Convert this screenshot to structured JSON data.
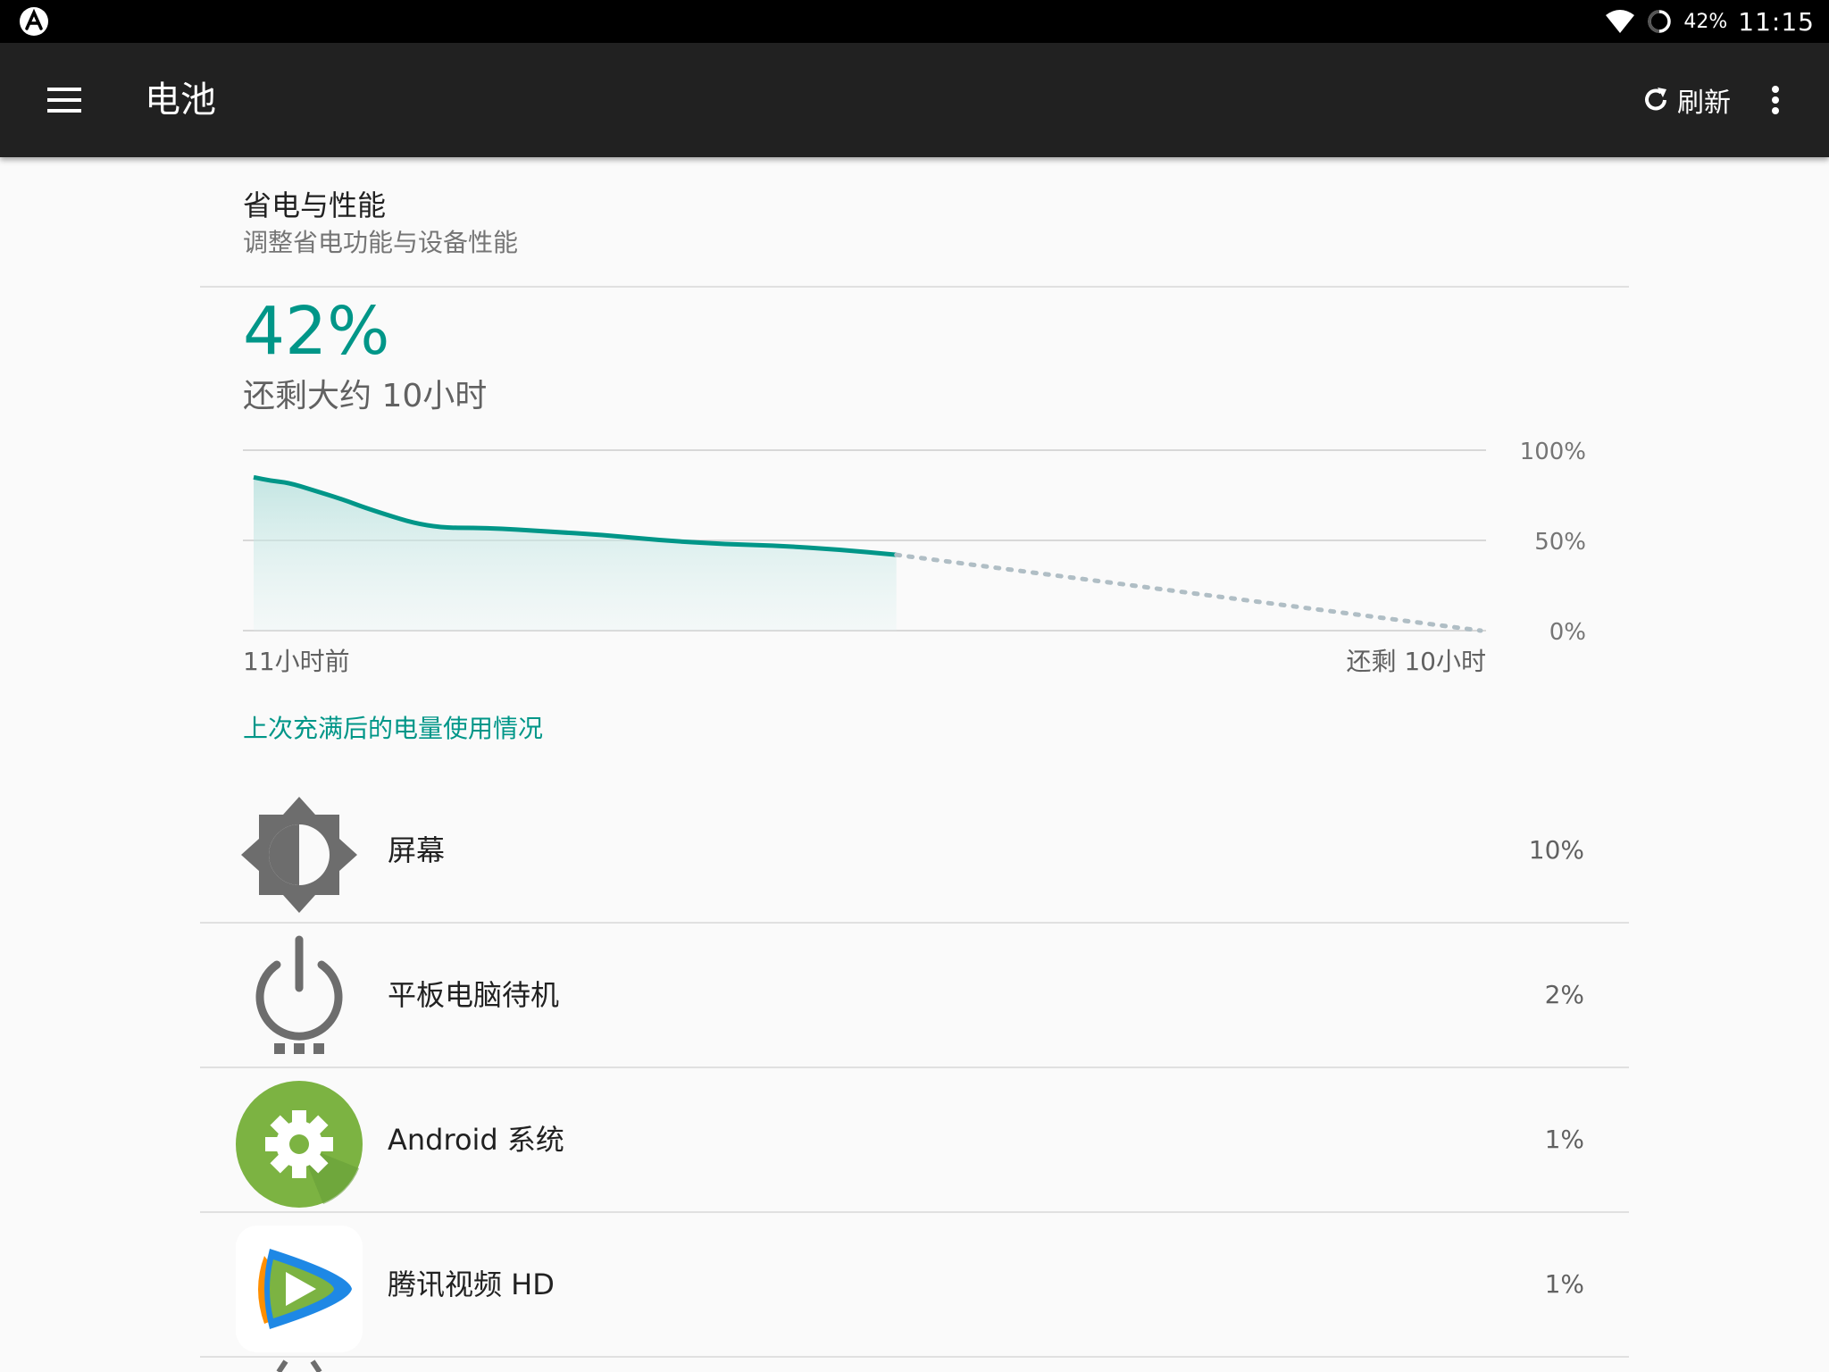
{
  "status_bar": {
    "battery_pct": "42%",
    "time": "11:15",
    "icons": [
      "app-notification-icon",
      "wifi-icon",
      "battery-icon"
    ]
  },
  "app_bar": {
    "title": "电池",
    "refresh_label": "刷新",
    "icons": [
      "menu-icon",
      "refresh-icon",
      "more-vert-icon"
    ]
  },
  "perf": {
    "title": "省电与性能",
    "subtitle": "调整省电功能与设备性能"
  },
  "battery": {
    "percent": "42%",
    "remaining": "还剩大约 10小时"
  },
  "chart_data": {
    "type": "line",
    "y_tick_labels": [
      "100%",
      "50%",
      "0%"
    ],
    "x_tick_labels": [
      "11小时前",
      "还剩 10小时"
    ],
    "ylim": [
      0,
      100
    ],
    "series": [
      {
        "style": "solid",
        "x": [
          0,
          0.3,
          0.6,
          1,
          1.5,
          2,
          3,
          4,
          5,
          6,
          7,
          8,
          9,
          10,
          11
        ],
        "values": [
          85,
          83,
          82,
          78,
          73,
          67,
          57,
          57,
          55,
          53,
          50,
          48,
          47,
          45,
          42
        ]
      },
      {
        "style": "dotted",
        "x": [
          11,
          21
        ],
        "values": [
          42,
          0
        ]
      }
    ],
    "x_range": [
      0,
      21
    ],
    "fill_under_solid": true,
    "grid": true,
    "colors": {
      "line": "#009688",
      "projection": "#b0bec5"
    }
  },
  "usage": {
    "header": "上次充满后的电量使用情况",
    "items": [
      {
        "label": "屏幕",
        "percent": "10%",
        "icon": "brightness-icon"
      },
      {
        "label": "平板电脑待机",
        "percent": "2%",
        "icon": "power-standby-icon"
      },
      {
        "label": "Android 系统",
        "percent": "1%",
        "icon": "android-system-gear-icon"
      },
      {
        "label": "腾讯视频 HD",
        "percent": "1%",
        "icon": "tencent-video-icon"
      }
    ]
  },
  "colors": {
    "accent": "#009688",
    "app_bar": "#212121",
    "background": "#fafafa"
  }
}
